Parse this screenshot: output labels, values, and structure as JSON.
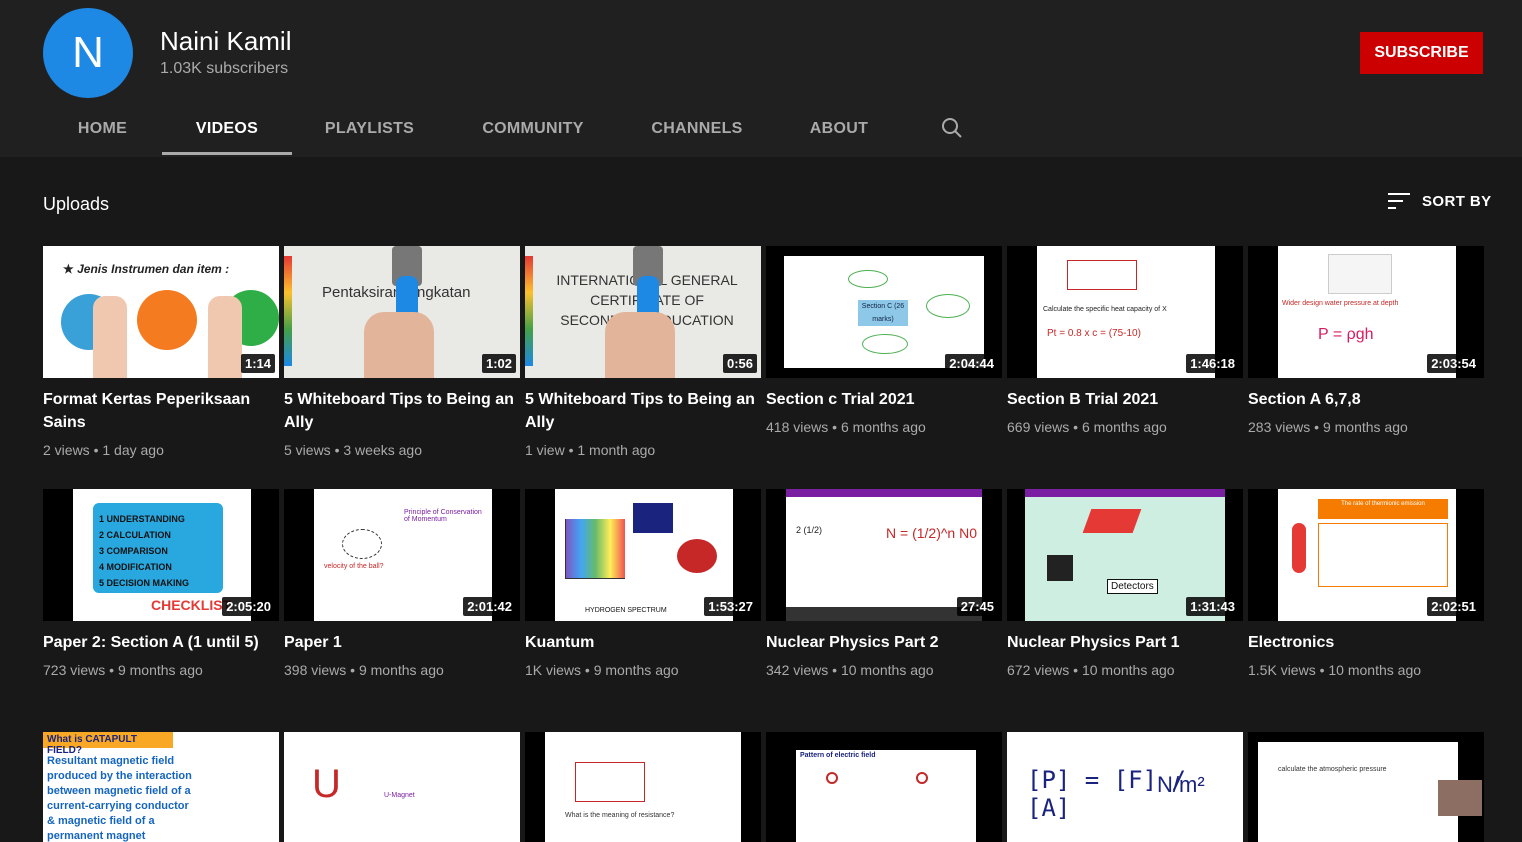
{
  "channel": {
    "initial": "N",
    "name": "Naini Kamil",
    "subscribers": "1.03K subscribers",
    "subscribe_label": "SUBSCRIBE",
    "accent": "#cc0000",
    "avatar_color": "#1e88e5"
  },
  "tabs": [
    {
      "label": "HOME",
      "active": false
    },
    {
      "label": "VIDEOS",
      "active": true
    },
    {
      "label": "PLAYLISTS",
      "active": false
    },
    {
      "label": "COMMUNITY",
      "active": false
    },
    {
      "label": "CHANNELS",
      "active": false
    },
    {
      "label": "ABOUT",
      "active": false
    }
  ],
  "search_icon": "search-icon",
  "section": {
    "title": "Uploads",
    "sort_label": "SORT BY",
    "sort_icon": "sort-icon"
  },
  "videos": [
    {
      "title": "Format Kertas Peperiksaan Sains",
      "duration": "1:14",
      "views": "2 views",
      "age": "1 day ago",
      "thumb": {
        "text": "Jenis Instrumen dan item :",
        "bg": "#ffffff"
      }
    },
    {
      "title": "5 Whiteboard Tips to Being an Ally",
      "duration": "1:02",
      "views": "5 views",
      "age": "3 weeks ago",
      "thumb": {
        "text": "Pentaksiran Tingkatan",
        "bg": "#e9e9e6"
      }
    },
    {
      "title": "5 Whiteboard Tips to Being an Ally",
      "duration": "0:56",
      "views": "1 view",
      "age": "1 month ago",
      "thumb": {
        "text": "INTERNATIONAL GENERAL CERTIFICATE OF SECONDARY EDUCATION",
        "bg": "#e9e9e6"
      }
    },
    {
      "title": "Section c Trial 2021",
      "duration": "2:04:44",
      "views": "418 views",
      "age": "6 months ago",
      "thumb": {
        "text": "Section C (26 marks)",
        "bg": "#ffffff"
      }
    },
    {
      "title": "Section B Trial 2021",
      "duration": "1:46:18",
      "views": "669 views",
      "age": "6 months ago",
      "thumb": {
        "text": "Calculate the specific heat capacity of X",
        "bg": "#ffffff"
      }
    },
    {
      "title": "Section A 6,7,8",
      "duration": "2:03:54",
      "views": "283 views",
      "age": "9 months ago",
      "thumb": {
        "text": "P = ρgh",
        "bg": "#ffffff"
      }
    },
    {
      "title": "Paper 2: Section A (1 until 5)",
      "duration": "2:05:20",
      "views": "723 views",
      "age": "9 months ago",
      "thumb": {
        "text": "CHECKLIST",
        "bg": "#ffffff"
      }
    },
    {
      "title": "Paper 1",
      "duration": "2:01:42",
      "views": "398 views",
      "age": "9 months ago",
      "thumb": {
        "text": "Principle of Conservation of Momentum",
        "bg": "#ffffff"
      }
    },
    {
      "title": "Kuantum",
      "duration": "1:53:27",
      "views": "1K views",
      "age": "9 months ago",
      "thumb": {
        "text": "HYDROGEN SPECTRUM",
        "bg": "#ffffff"
      }
    },
    {
      "title": "Nuclear Physics Part 2",
      "duration": "27:45",
      "views": "342 views",
      "age": "10 months ago",
      "thumb": {
        "text": "N = (1/2)^n N0",
        "bg": "#ffffff"
      }
    },
    {
      "title": "Nuclear Physics Part 1",
      "duration": "1:31:43",
      "views": "672 views",
      "age": "10 months ago",
      "thumb": {
        "text": "Detectors",
        "bg": "#cdeee0"
      }
    },
    {
      "title": "Electronics",
      "duration": "2:02:51",
      "views": "1.5K views",
      "age": "10 months ago",
      "thumb": {
        "text": "The rate of thermionic emission",
        "bg": "#ffffff"
      }
    }
  ],
  "partial_row": [
    {
      "thumb": {
        "text": "What is CATAPULT FIELD?",
        "bg": "#ffffff"
      }
    },
    {
      "thumb": {
        "text": "U-Magnet",
        "bg": "#ffffff"
      }
    },
    {
      "thumb": {
        "text": "What is the meaning of resistance?",
        "bg": "#ffffff"
      }
    },
    {
      "thumb": {
        "text": "Pattern of electric field",
        "bg": "#ffffff"
      }
    },
    {
      "thumb": {
        "text": "[P] = [F] / [A]",
        "bg": "#ffffff"
      }
    },
    {
      "thumb": {
        "text": "calculate the atmospheric pressure",
        "bg": "#ffffff"
      }
    }
  ]
}
